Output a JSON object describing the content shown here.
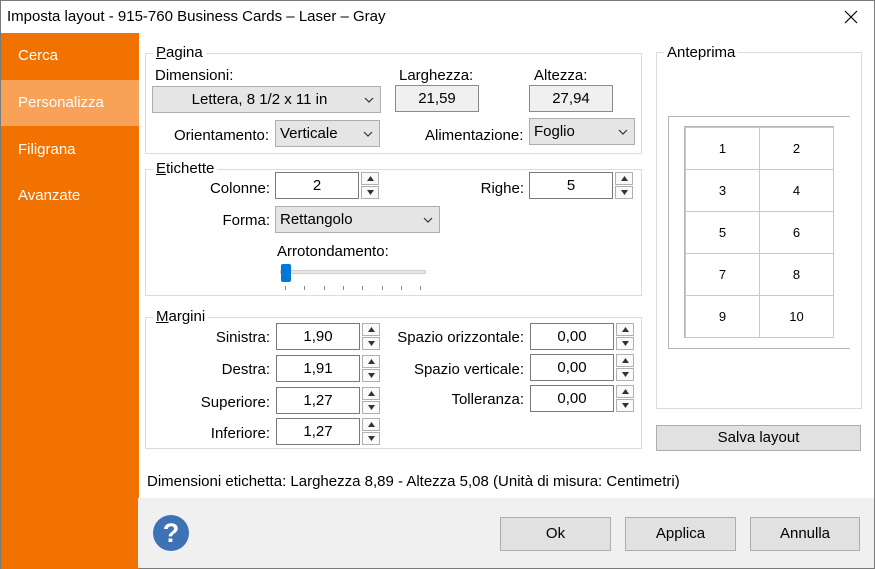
{
  "window": {
    "title": "Imposta layout - 915-760 Business Cards – Laser – Gray"
  },
  "sidebar": {
    "items": [
      {
        "label": "Cerca",
        "active": false
      },
      {
        "label": "Personalizza",
        "active": true
      },
      {
        "label": "Filigrana",
        "active": false
      },
      {
        "label": "Avanzate",
        "active": false
      }
    ]
  },
  "pagina": {
    "title_first": "P",
    "title_rest": "agina",
    "dimensioni_label": "Dimensioni:",
    "dimensioni_value": "Lettera, 8 1/2 x 11 in",
    "larghezza_label": "Larghezza:",
    "larghezza_value": "21,59",
    "altezza_label": "Altezza:",
    "altezza_value": "27,94",
    "orientamento_label": "Orientamento:",
    "orientamento_value": "Verticale",
    "alimentazione_label": "Alimentazione:",
    "alimentazione_value": "Foglio"
  },
  "etichette": {
    "title_first": "E",
    "title_rest": "tichette",
    "colonne_label": "Colonne:",
    "colonne_value": "2",
    "righe_label": "Righe:",
    "righe_value": "5",
    "forma_label": "Forma:",
    "forma_value": "Rettangolo",
    "arrotondamento_label": "Arrotondamento:",
    "arrotondamento_level": 0
  },
  "margini": {
    "title_first": "M",
    "title_rest": "argini",
    "sinistra_label": "Sinistra:",
    "sinistra_value": "1,90",
    "destra_label": "Destra:",
    "destra_value": "1,91",
    "superiore_label": "Superiore:",
    "superiore_value": "1,27",
    "inferiore_label": "Inferiore:",
    "inferiore_value": "1,27",
    "spazio_orizzontale_label": "Spazio orizzontale:",
    "spazio_orizzontale_value": "0,00",
    "spazio_verticale_label": "Spazio verticale:",
    "spazio_verticale_value": "0,00",
    "tolleranza_label": "Tolleranza:",
    "tolleranza_value": "0,00"
  },
  "anteprima": {
    "title": "Anteprima",
    "cells": [
      "1",
      "2",
      "3",
      "4",
      "5",
      "6",
      "7",
      "8",
      "9",
      "10"
    ],
    "save_label": "Salva layout"
  },
  "status_text": "Dimensioni etichetta: Larghezza 8,89 - Altezza 5,08 (Unità di misura: Centimetri)",
  "buttons": {
    "ok": "Ok",
    "applica": "Applica",
    "annulla": "Annulla"
  },
  "help_glyph": "?",
  "colors": {
    "sidebar": "#f27200",
    "sidebar_active": "#f7a257",
    "accent": "#0078d7",
    "help": "#3e72b4"
  }
}
